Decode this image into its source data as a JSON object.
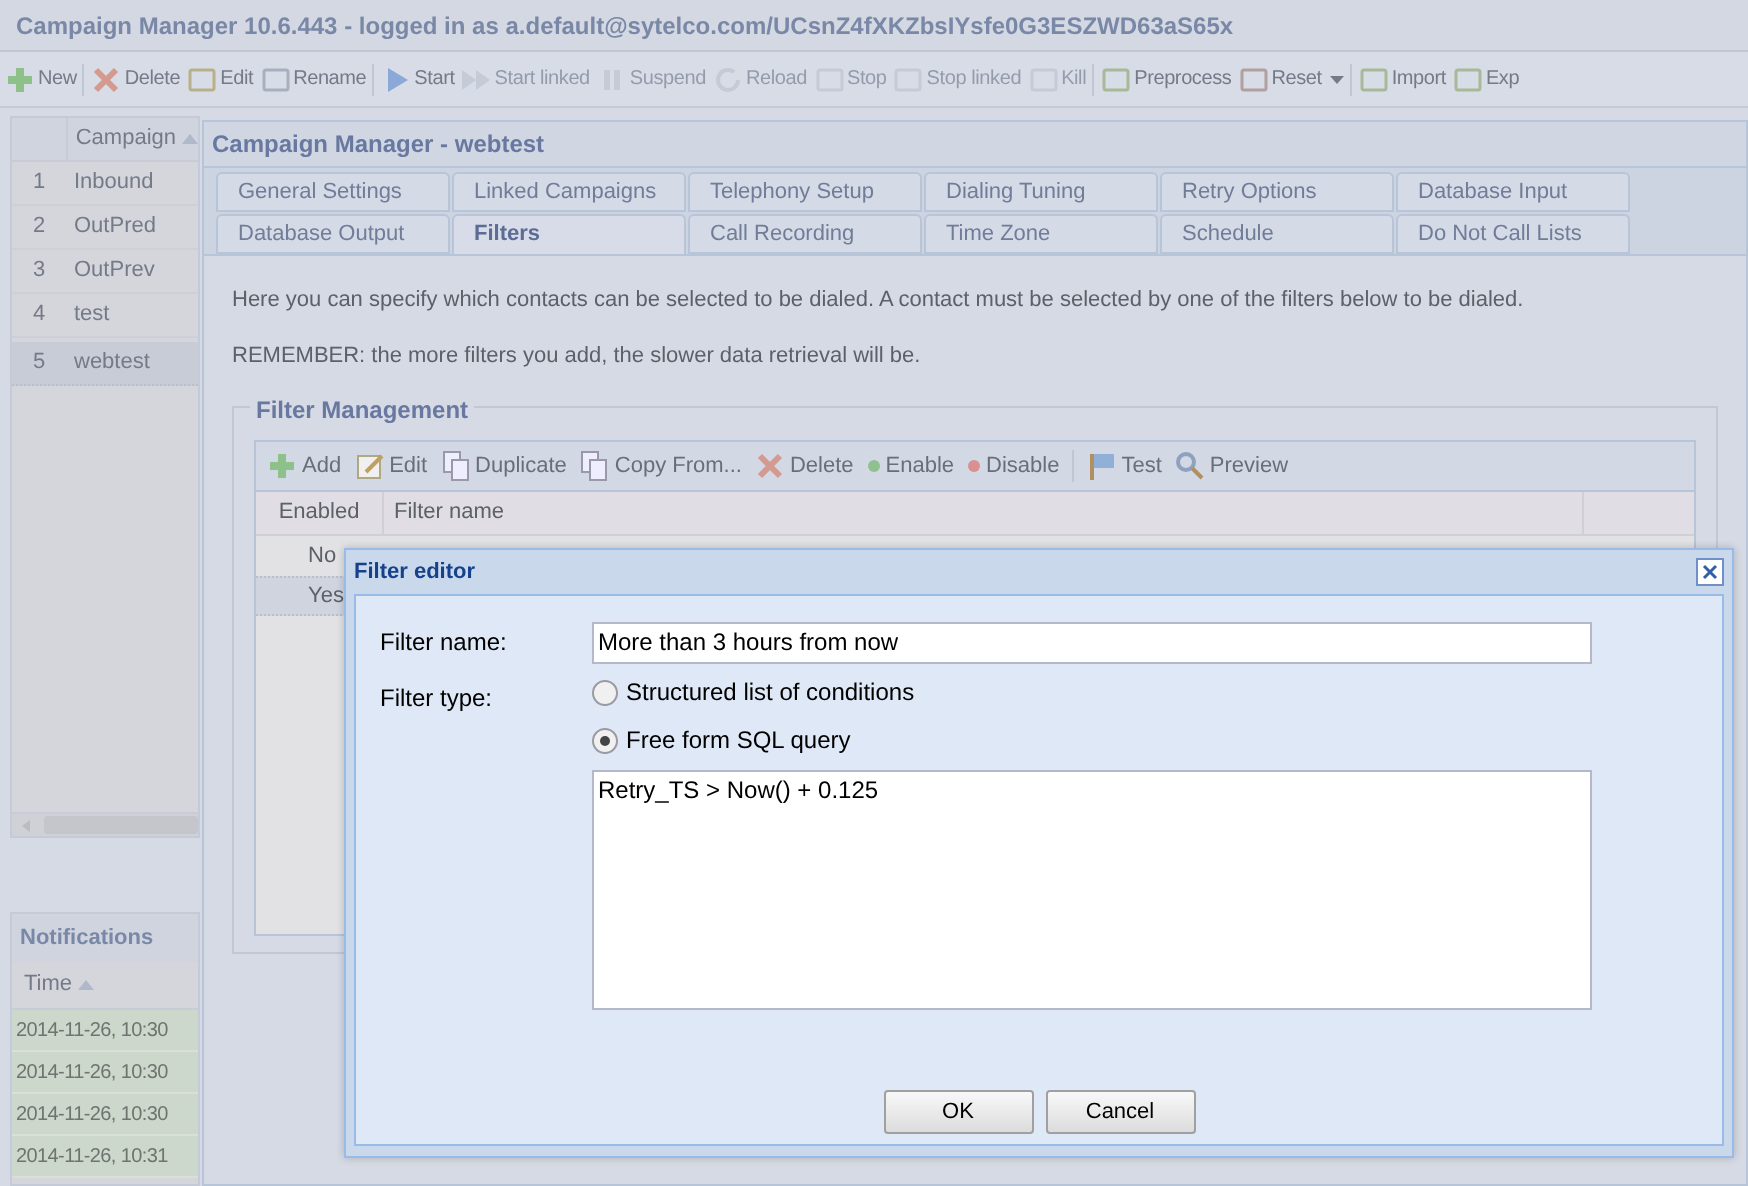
{
  "app_title": "Campaign Manager 10.6.443 - logged in as a.default@sytelco.com/UCsnZ4fXKZbsIYsfe0G3ESZWD63aS65x",
  "toolbar": [
    {
      "label": "New",
      "disabled": false
    },
    {
      "label": "Delete",
      "disabled": false
    },
    {
      "label": "Edit",
      "disabled": false
    },
    {
      "label": "Rename",
      "disabled": false
    },
    {
      "label": "Start",
      "disabled": false
    },
    {
      "label": "Start linked",
      "disabled": true
    },
    {
      "label": "Suspend",
      "disabled": true
    },
    {
      "label": "Reload",
      "disabled": true
    },
    {
      "label": "Stop",
      "disabled": true
    },
    {
      "label": "Stop linked",
      "disabled": true
    },
    {
      "label": "Kill",
      "disabled": true
    },
    {
      "label": "Preprocess",
      "disabled": false
    },
    {
      "label": "Reset",
      "disabled": false
    },
    {
      "label": "Import",
      "disabled": false
    },
    {
      "label": "Exp",
      "disabled": false
    }
  ],
  "campaign_list": {
    "column": "Campaign",
    "rows": [
      {
        "number": "1",
        "name": "Inbound",
        "selected": false
      },
      {
        "number": "2",
        "name": "OutPred",
        "selected": false
      },
      {
        "number": "3",
        "name": "OutPrev",
        "selected": false
      },
      {
        "number": "4",
        "name": "test",
        "selected": false
      },
      {
        "number": "5",
        "name": "webtest",
        "selected": true
      }
    ]
  },
  "notifications": {
    "title": "Notifications",
    "column": "Time",
    "rows": [
      "2014-11-26, 10:30",
      "2014-11-26, 10:30",
      "2014-11-26, 10:30",
      "2014-11-26, 10:31"
    ]
  },
  "window": {
    "title": "Campaign Manager - webtest",
    "tabs": [
      {
        "label": "General Settings",
        "selected": false
      },
      {
        "label": "Linked Campaigns",
        "selected": false
      },
      {
        "label": "Telephony Setup",
        "selected": false
      },
      {
        "label": "Dialing Tuning",
        "selected": false
      },
      {
        "label": "Retry Options",
        "selected": false
      },
      {
        "label": "Database Input",
        "selected": false
      },
      {
        "label": "Database Output",
        "selected": false
      },
      {
        "label": "Filters",
        "selected": true
      },
      {
        "label": "Call Recording",
        "selected": false
      },
      {
        "label": "Time Zone",
        "selected": false
      },
      {
        "label": "Schedule",
        "selected": false
      },
      {
        "label": "Do Not Call Lists",
        "selected": false
      }
    ],
    "intro": [
      "Here you can specify which contacts can be selected to be dialed. A contact must be selected by one of the filters below to be dialed.",
      "REMEMBER: the more filters you add, the slower data retrieval will be."
    ],
    "filter_management": {
      "legend": "Filter Management",
      "toolbar": [
        "Add",
        "Edit",
        "Duplicate",
        "Copy From...",
        "Delete",
        "Enable",
        "Disable",
        "Test",
        "Preview"
      ],
      "columns": [
        "Enabled",
        "Filter name"
      ],
      "rows": [
        {
          "enabled": "No",
          "selected": false
        },
        {
          "enabled": "Yes",
          "selected": true
        }
      ]
    }
  },
  "dialog": {
    "title": "Filter editor",
    "name_label": "Filter name:",
    "name_value": "More than 3 hours from now",
    "type_label": "Filter type:",
    "options": [
      {
        "label": "Structured list of conditions",
        "selected": false
      },
      {
        "label": "Free form SQL query",
        "selected": true
      }
    ],
    "query": "Retry_TS > Now() + 0.125",
    "buttons": [
      "OK",
      "Cancel"
    ]
  }
}
